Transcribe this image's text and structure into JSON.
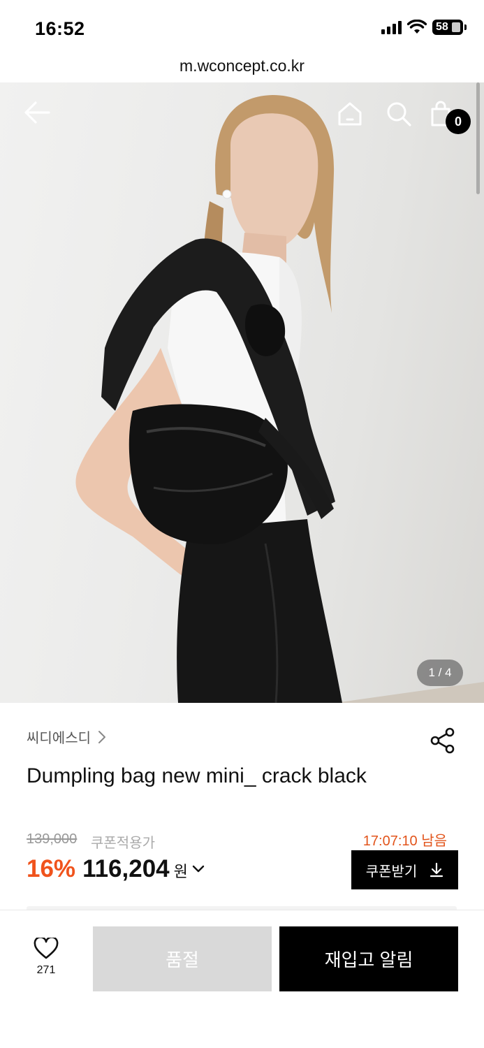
{
  "status_bar": {
    "time": "16:52",
    "battery": "58"
  },
  "browser": {
    "url": "m.wconcept.co.kr"
  },
  "header": {
    "cart_count": "0"
  },
  "gallery": {
    "page_indicator": "1 / 4"
  },
  "product": {
    "brand": "씨디에스디",
    "title": "Dumpling bag new mini_ crack black",
    "original_price": "139,000",
    "coupon_label": "쿠폰적용가",
    "timer": "17:07:10 남음",
    "discount": "16%",
    "price": "116,204",
    "currency": "원",
    "coupon_button": "쿠폰받기"
  },
  "bottom_bar": {
    "wish_count": "271",
    "soldout_label": "품절",
    "restock_label": "재입고 알림"
  },
  "colors": {
    "accent": "#f0531c",
    "timer": "#e2541b",
    "primary_button": "#000000",
    "disabled_button": "#d9d9d9"
  },
  "icons": [
    "back-arrow-icon",
    "home-icon",
    "search-icon",
    "shopping-bag-icon",
    "chevron-right-icon",
    "share-icon",
    "chevron-down-icon",
    "download-icon",
    "heart-icon",
    "signal-icon",
    "wifi-icon",
    "battery-icon"
  ]
}
